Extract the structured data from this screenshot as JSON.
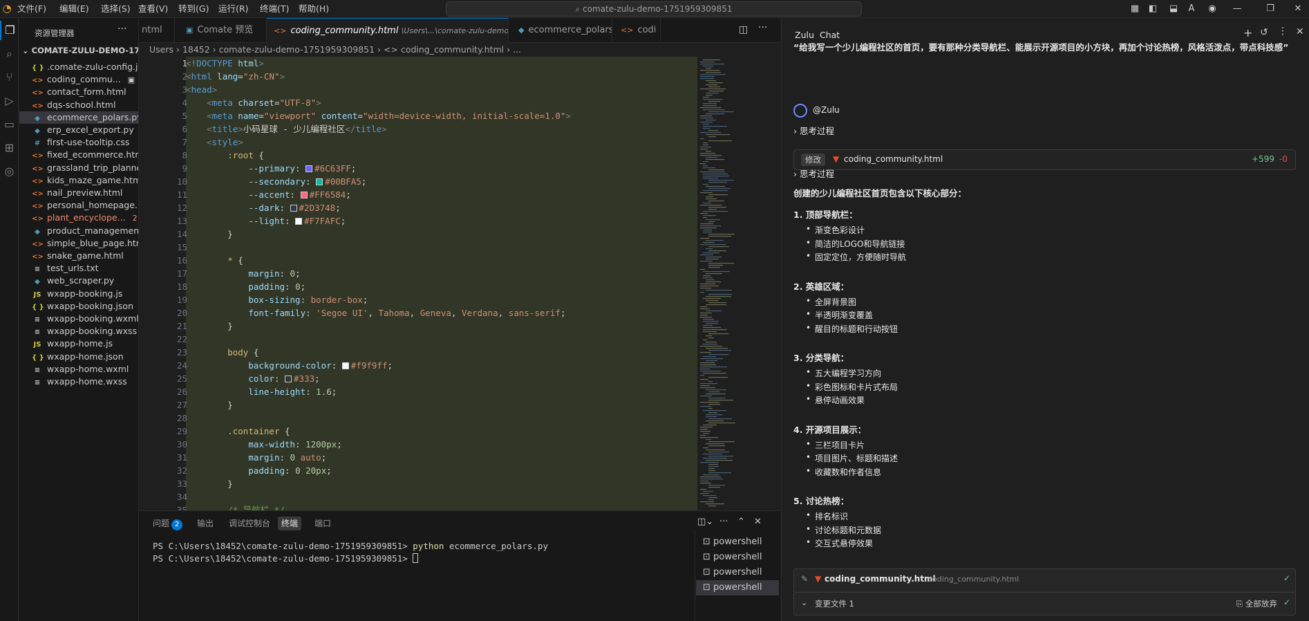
{
  "titlebar": {
    "menus": [
      "文件(F)",
      "编辑(E)",
      "选择(S)",
      "查看(V)",
      "转到(G)",
      "运行(R)",
      "终端(T)",
      "帮助(H)"
    ],
    "search_text": "comate-zulu-demo-1751959309851"
  },
  "explorer": {
    "title": "资源管理器",
    "more": "···",
    "folder": "COMATE-ZULU-DEMO-175...",
    "files": [
      {
        "icon": "{ }",
        "name": ".comate-zulu-config.j...",
        "color": "#cccccc",
        "iconColor": "#cbcb41"
      },
      {
        "icon": "<>",
        "name": "coding_commu...",
        "color": "#cccccc",
        "iconColor": "#e37933",
        "extra": "▣"
      },
      {
        "icon": "<>",
        "name": "contact_form.html",
        "color": "#cccccc",
        "iconColor": "#e37933"
      },
      {
        "icon": "<>",
        "name": "dqs-school.html",
        "color": "#cccccc",
        "iconColor": "#e37933"
      },
      {
        "icon": "◆",
        "name": "ecommerce_polars.py",
        "color": "#cccccc",
        "iconColor": "#519aba",
        "selected": true
      },
      {
        "icon": "◆",
        "name": "erp_excel_export.py",
        "color": "#cccccc",
        "iconColor": "#519aba"
      },
      {
        "icon": "#",
        "name": "first-use-tooltip.css",
        "color": "#cccccc",
        "iconColor": "#519aba"
      },
      {
        "icon": "<>",
        "name": "fixed_ecommerce.html",
        "color": "#cccccc",
        "iconColor": "#e37933"
      },
      {
        "icon": "<>",
        "name": "grassland_trip_planne...",
        "color": "#cccccc",
        "iconColor": "#e37933"
      },
      {
        "icon": "<>",
        "name": "kids_maze_game.html",
        "color": "#cccccc",
        "iconColor": "#e37933"
      },
      {
        "icon": "<>",
        "name": "nail_preview.html",
        "color": "#cccccc",
        "iconColor": "#e37933"
      },
      {
        "icon": "<>",
        "name": "personal_homepage....",
        "color": "#cccccc",
        "iconColor": "#e37933"
      },
      {
        "icon": "<>",
        "name": "plant_encyclope...",
        "color": "#f48771",
        "iconColor": "#e37933",
        "extra": "2"
      },
      {
        "icon": "◆",
        "name": "product_managemen...",
        "color": "#cccccc",
        "iconColor": "#519aba"
      },
      {
        "icon": "<>",
        "name": "simple_blue_page.html",
        "color": "#cccccc",
        "iconColor": "#e37933"
      },
      {
        "icon": "<>",
        "name": "snake_game.html",
        "color": "#cccccc",
        "iconColor": "#e37933"
      },
      {
        "icon": "≡",
        "name": "test_urls.txt",
        "color": "#cccccc",
        "iconColor": "#cccccc"
      },
      {
        "icon": "◆",
        "name": "web_scraper.py",
        "color": "#cccccc",
        "iconColor": "#519aba"
      },
      {
        "icon": "JS",
        "name": "wxapp-booking.js",
        "color": "#cccccc",
        "iconColor": "#cbcb41"
      },
      {
        "icon": "{ }",
        "name": "wxapp-booking.json",
        "color": "#cccccc",
        "iconColor": "#cbcb41"
      },
      {
        "icon": "≡",
        "name": "wxapp-booking.wxml",
        "color": "#cccccc",
        "iconColor": "#cccccc"
      },
      {
        "icon": "≡",
        "name": "wxapp-booking.wxss",
        "color": "#cccccc",
        "iconColor": "#cccccc"
      },
      {
        "icon": "JS",
        "name": "wxapp-home.js",
        "color": "#cccccc",
        "iconColor": "#cbcb41"
      },
      {
        "icon": "{ }",
        "name": "wxapp-home.json",
        "color": "#cccccc",
        "iconColor": "#cbcb41"
      },
      {
        "icon": "≡",
        "name": "wxapp-home.wxml",
        "color": "#cccccc",
        "iconColor": "#cccccc"
      },
      {
        "icon": "≡",
        "name": "wxapp-home.wxss",
        "color": "#cccccc",
        "iconColor": "#cccccc"
      }
    ]
  },
  "tabs": [
    {
      "label": "ntml",
      "active": false
    },
    {
      "label": "Comate 预览",
      "active": false
    },
    {
      "label": "coding_community.html",
      "sub": "\\Users\\...\\comate-zulu-demo-1751959309851",
      "active": true
    },
    {
      "label": "ecommerce_polars.py",
      "active": false
    },
    {
      "label": "codi",
      "active": false
    }
  ],
  "breadcrumb": "Users  ›  18452  ›  comate-zulu-demo-1751959309851  ›  <> coding_community.html  ›  ...",
  "panel": {
    "tabs": [
      "问题",
      "输出",
      "调试控制台",
      "终端",
      "端口"
    ],
    "problems_count": "2",
    "terminal_lines": [
      "PS C:\\Users\\18452\\comate-zulu-demo-1751959309851> ",
      "PS C:\\Users\\18452\\comate-zulu-demo-1751959309851> "
    ],
    "command": "python",
    "command_arg": " ecommerce_polars.py",
    "shells": [
      "powershell",
      "powershell",
      "powershell",
      "powershell"
    ]
  },
  "chat": {
    "tab_zulu": "Zulu",
    "tab_chat": "Chat",
    "quote": "“给我写一个少儿编程社区的首页，要有那种分类导航栏、能展示开源项目的小方块，再加个讨论热榜，风格活泼点，带点科技感”",
    "agent": "@Zulu",
    "thinking1": "思考过程",
    "modify_tag": "修改",
    "modify_file": "coding_community.html",
    "added": "+599",
    "removed": "-0",
    "thinking2": "思考过程",
    "intro": "创建的少儿编程社区首页包含以下核心部分：",
    "sections": [
      {
        "title": "1. 顶部导航栏：",
        "items": [
          "渐变色彩设计",
          "简洁的LOGO和导航链接",
          "固定定位，方便随时导航"
        ]
      },
      {
        "title": "2. 英雄区域：",
        "items": [
          "全屏背景图",
          "半透明渐变覆盖",
          "醒目的标题和行动按钮"
        ]
      },
      {
        "title": "3. 分类导航：",
        "items": [
          "五大编程学习方向",
          "彩色图标和卡片式布局",
          "悬停动画效果"
        ]
      },
      {
        "title": "4. 开源项目展示：",
        "items": [
          "三栏项目卡片",
          "项目图片、标题和描述",
          "收藏数和作者信息"
        ]
      },
      {
        "title": "5. 讨论热榜：",
        "items": [
          "排名标识",
          "讨论标题和元数据",
          "交互式悬停效果"
        ]
      }
    ],
    "bottom_file": "coding_community.html",
    "bottom_file_path": "coding_community.html",
    "changed_files": "变更文件 1",
    "discard_all": "全部放弃"
  },
  "colors": {
    "accent": "#0078d4",
    "primary": "#6C63FF",
    "secondary": "#00BFA5",
    "accentPink": "#FF6584",
    "dark": "#2D3748",
    "light": "#F7FAFC",
    "bodyBg": "#f9f9ff",
    "text": "#333"
  }
}
